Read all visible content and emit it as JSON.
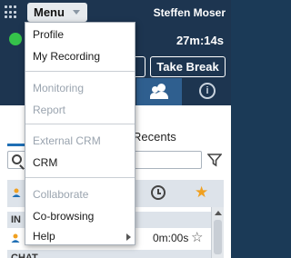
{
  "header": {
    "menu_label": "Menu",
    "user_name": "Steffen Moser",
    "timer": "27m:14s",
    "take_break_label": "Take Break"
  },
  "status": {
    "state_color": "#35c24a"
  },
  "tabs": {
    "recents_label": "Recents"
  },
  "table": {
    "groups": [
      {
        "label": "IN"
      },
      {
        "label": "CHAT"
      }
    ],
    "rows": [
      {
        "time": "0m:00s",
        "favorite_icon": "star-outline-icon"
      }
    ]
  },
  "menu": {
    "items": [
      {
        "label": "Profile",
        "enabled": true
      },
      {
        "label": "My Recording",
        "enabled": true
      },
      {
        "label": "Monitoring",
        "enabled": false
      },
      {
        "label": "Report",
        "enabled": false
      },
      {
        "label": "External CRM",
        "enabled": false
      },
      {
        "label": "CRM",
        "enabled": true
      },
      {
        "label": "Collaborate",
        "enabled": false
      },
      {
        "label": "Co-browsing",
        "enabled": true
      },
      {
        "label": "Help",
        "enabled": true,
        "submenu": true
      }
    ]
  },
  "colors": {
    "header_bg": "#1d3550",
    "accent": "#1f6fb5",
    "favorite": "#f0a020"
  }
}
